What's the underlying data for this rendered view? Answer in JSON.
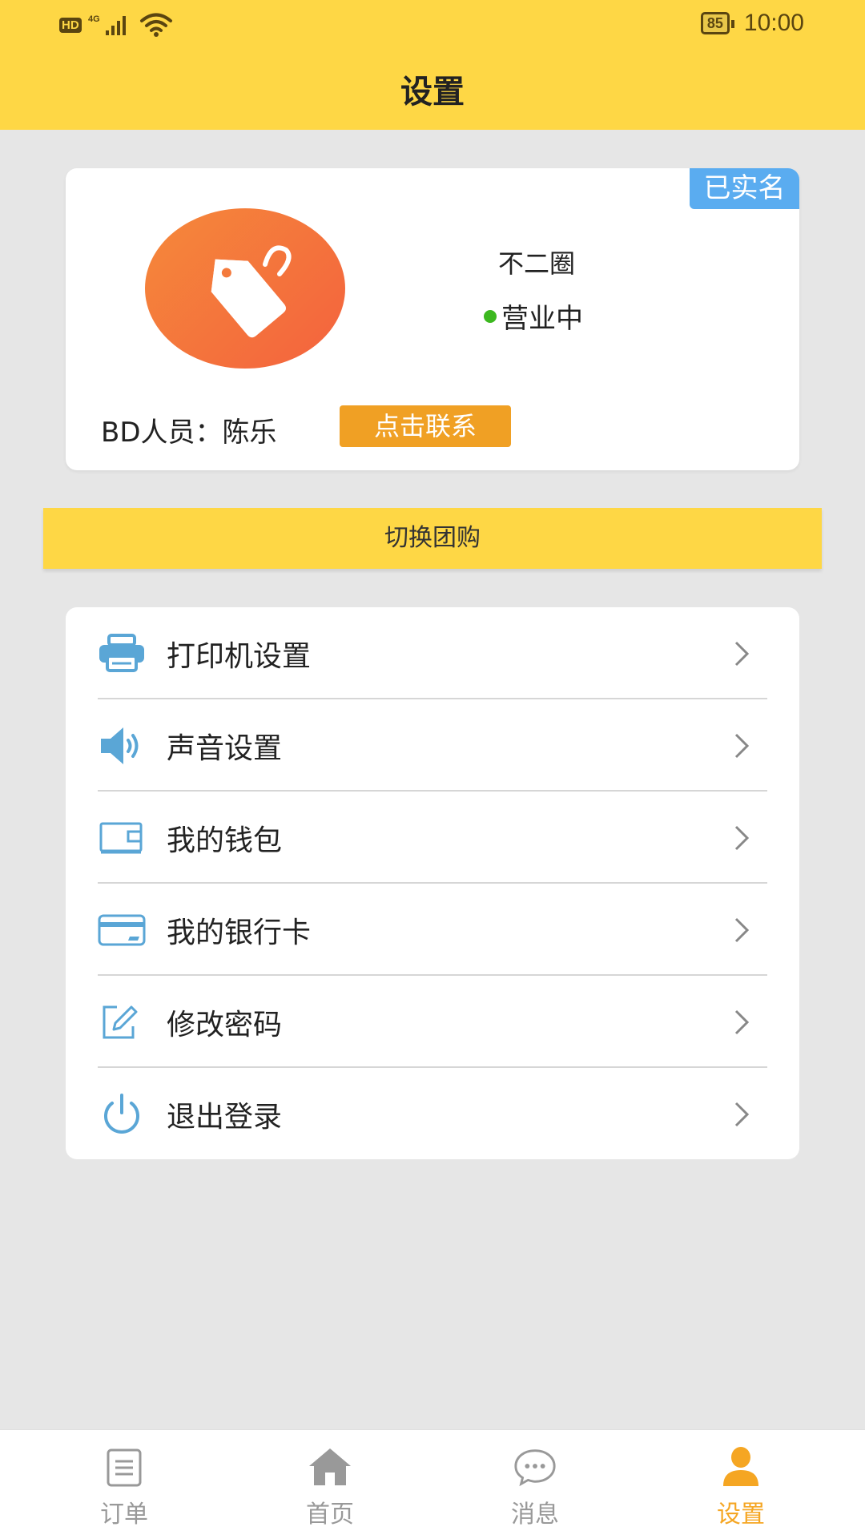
{
  "status_bar": {
    "hd": "HD",
    "network": "4G",
    "battery": "85",
    "time": "10:00"
  },
  "header": {
    "title": "设置"
  },
  "profile": {
    "verified_badge": "已实名",
    "avatar_icon": "tag-icon",
    "shop_name": "不二圈",
    "status": "营业中",
    "status_color": "#3cb81f",
    "bd_label": "BD人员：陈乐",
    "contact_button": "点击联系"
  },
  "switch_button": {
    "label": "切换团购"
  },
  "menu": {
    "items": [
      {
        "label": "打印机设置",
        "icon": "printer-icon"
      },
      {
        "label": "声音设置",
        "icon": "speaker-icon"
      },
      {
        "label": "我的钱包",
        "icon": "wallet-icon"
      },
      {
        "label": "我的银行卡",
        "icon": "bank-card-icon"
      },
      {
        "label": "修改密码",
        "icon": "edit-icon"
      },
      {
        "label": "退出登录",
        "icon": "power-icon"
      }
    ]
  },
  "bottom_nav": {
    "tabs": [
      {
        "label": "订单",
        "icon": "order-icon",
        "active": false
      },
      {
        "label": "首页",
        "icon": "home-icon",
        "active": false
      },
      {
        "label": "消息",
        "icon": "message-icon",
        "active": false
      },
      {
        "label": "设置",
        "icon": "user-icon",
        "active": true
      }
    ]
  },
  "colors": {
    "brand_yellow": "#fed745",
    "accent_orange": "#f0a024",
    "icon_blue": "#5aa6d6",
    "active_tab": "#f5a623"
  }
}
